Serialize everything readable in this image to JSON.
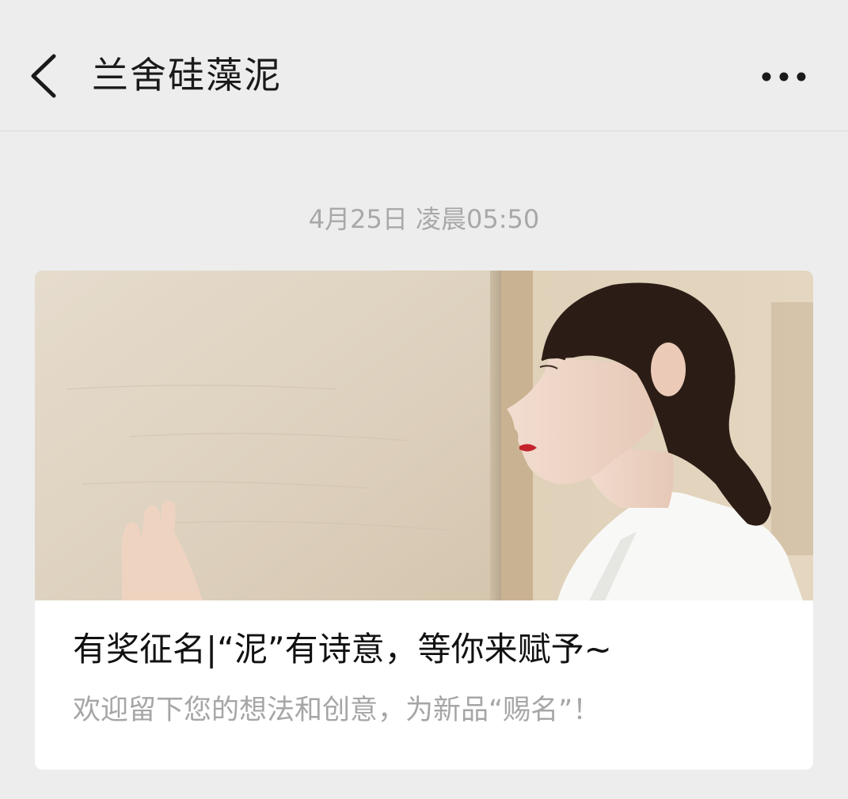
{
  "header": {
    "title": "兰舍硅藻泥",
    "back_icon": "chevron-left-icon",
    "more_icon": "more-horizontal-icon"
  },
  "message": {
    "timestamp": "4月25日 凌晨05:50"
  },
  "article": {
    "title": "有奖征名|“泥”有诗意，等你来赋予~",
    "digest": "欢迎留下您的想法和创意，为新品“赐名”！"
  },
  "colors": {
    "background": "#ededed",
    "card": "#ffffff",
    "title_text": "#111111",
    "muted_text": "#a6a6a6"
  }
}
